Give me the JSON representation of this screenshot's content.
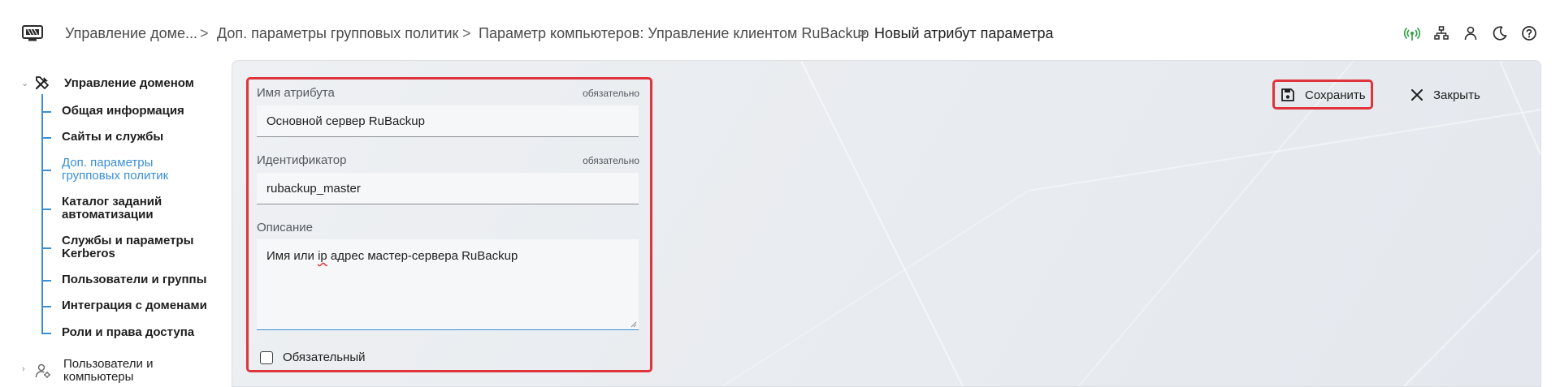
{
  "breadcrumb": {
    "items": [
      "Управление доме...",
      "Доп. параметры групповых политик",
      "Параметр компьютеров: Управление клиентом RuBackup",
      "Новый атрибут параметра"
    ],
    "separator": ">"
  },
  "header_icons": [
    "network-status-icon",
    "hierarchy-icon",
    "user-icon",
    "dark-mode-icon",
    "help-icon"
  ],
  "sidebar": {
    "root_label": "Управление доменом",
    "items": [
      "Общая информация",
      "Сайты и службы",
      "Доп. параметры групповых политик",
      "Каталог заданий автоматизации",
      "Службы и параметры Kerberos",
      "Пользователи и группы",
      "Интеграция с доменами",
      "Роли и права доступа"
    ],
    "active_index": 2,
    "second_root_label": "Пользователи и компьютеры"
  },
  "form": {
    "attribute_name": {
      "label": "Имя атрибута",
      "required_text": "обязательно",
      "value": "Основной сервер RuBackup"
    },
    "identifier": {
      "label": "Идентификатор",
      "required_text": "обязательно",
      "value": "rubackup_master"
    },
    "description": {
      "label": "Описание",
      "value_before": "Имя или ",
      "value_misspelled": "ip",
      "value_after": " адрес мастер-сервера RuBackup"
    },
    "required_checkbox": {
      "label": "Обязательный",
      "checked": false
    }
  },
  "toolbar": {
    "save_label": "Сохранить",
    "close_label": "Закрыть"
  },
  "colors": {
    "accent": "#3a8fd6",
    "highlight": "#e0343c",
    "status_green": "#2ea043"
  }
}
